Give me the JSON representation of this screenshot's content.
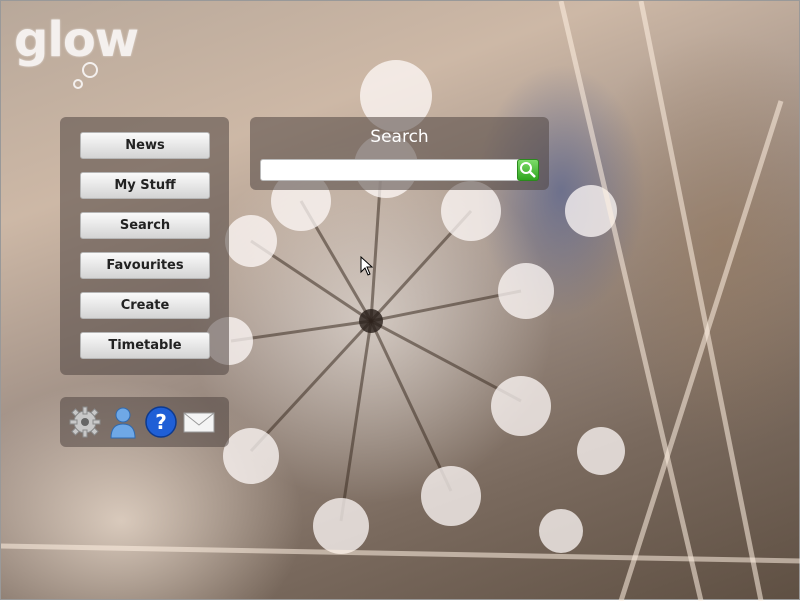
{
  "app": {
    "logo_text": "glow"
  },
  "nav": {
    "items": [
      {
        "label": "News"
      },
      {
        "label": "My Stuff"
      },
      {
        "label": "Search"
      },
      {
        "label": "Favourites"
      },
      {
        "label": "Create"
      },
      {
        "label": "Timetable"
      }
    ]
  },
  "search": {
    "title": "Search",
    "value": "",
    "placeholder": "",
    "button_icon": "magnifier-icon",
    "button_color": "#3cb52a"
  },
  "tools": [
    {
      "icon": "gear-icon"
    },
    {
      "icon": "user-icon"
    },
    {
      "icon": "help-icon"
    },
    {
      "icon": "mail-icon"
    }
  ],
  "colors": {
    "panel_bg": "rgba(80,70,65,0.55)",
    "button_text": "#222222",
    "help_blue": "#1f5fd6"
  }
}
